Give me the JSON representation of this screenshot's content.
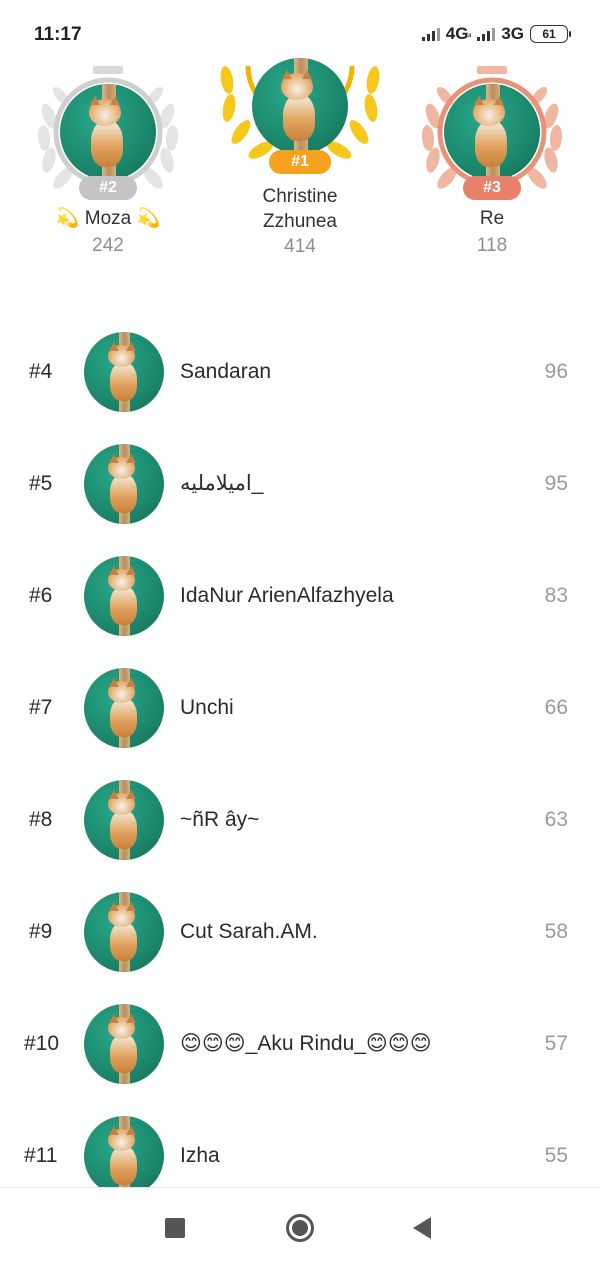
{
  "status_bar": {
    "time": "11:17",
    "network_1": "4G",
    "network_1_sub": "ᵢₗ",
    "network_2": "3G",
    "battery": "61"
  },
  "podium": {
    "first": {
      "rank_label": "#1",
      "name": "Christine Zzhunea",
      "score": "414",
      "color": "#f5c518"
    },
    "second": {
      "rank_label": "#2",
      "name": "💫 Moza 💫",
      "score": "242",
      "color": "#c8c8c8"
    },
    "third": {
      "rank_label": "#3",
      "name": "Re",
      "score": "118",
      "color": "#e89a84"
    }
  },
  "leaderboard": [
    {
      "rank": "#4",
      "name": "Sandaran",
      "score": "96"
    },
    {
      "rank": "#5",
      "name": "اميلامليه_",
      "score": "95"
    },
    {
      "rank": "#6",
      "name": "IdaNur ArienAlfazhyela",
      "score": "83"
    },
    {
      "rank": "#7",
      "name": "Unchi",
      "score": "66"
    },
    {
      "rank": "#8",
      "name": "~ñR ây~",
      "score": "63"
    },
    {
      "rank": "#9",
      "name": "Cut Sarah.AM.",
      "score": "58"
    },
    {
      "rank": "#10",
      "name": "😊😊😊_Aku Rindu_😊😊😊",
      "score": "57"
    },
    {
      "rank": "#11",
      "name": "Izha",
      "score": "55"
    }
  ]
}
